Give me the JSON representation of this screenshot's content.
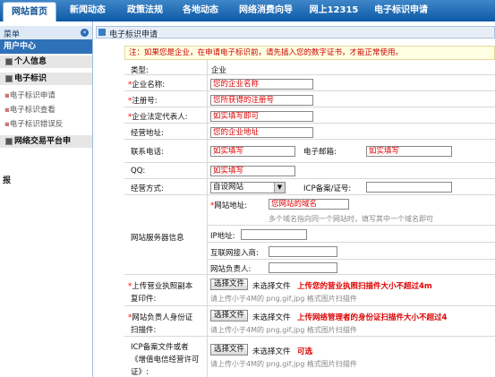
{
  "nav": {
    "items": [
      "网站首页",
      "新闻动态",
      "政策法规",
      "各地动态",
      "网络消费向导",
      "网上12315",
      "电子标识申请"
    ]
  },
  "sidebar": {
    "header": "菜单",
    "toggle": "«",
    "user_center": "用户中心",
    "personal_info": "个人信息",
    "e_label": "电子标识",
    "sub_items": [
      "电子标识申请",
      "电子标识查看",
      "电子标识错误反"
    ],
    "platform": "网络交易平台申",
    "extra": "报"
  },
  "main": {
    "title": "电子标识申请"
  },
  "form": {
    "note": "注：如果您是企业，在申请电子标识前，请先插入您的数字证书，才能正常使用。",
    "type_label": "类型:",
    "type_value": "企业",
    "company_label": "企业名称:",
    "company_value": "您的企业名称",
    "reg_label": "注册号:",
    "reg_value": "您所获得的注册号",
    "legal_label": "企业法定代表人:",
    "legal_value": "如实填写即可",
    "addr_label": "经营地址:",
    "addr_value": "您的企业地址",
    "phone_label": "联系电话:",
    "phone_value": "如实填写",
    "email_label": "电子邮箱:",
    "email_value": "如实填写",
    "qq_label": "QQ:",
    "qq_value": "如实填写",
    "mode_label": "经营方式:",
    "mode_value": "自设网站",
    "icp_label": "ICP备案/证号:",
    "server_label": "网站服务器信息",
    "site_label": "网站地址:",
    "site_value": "您网站的域名",
    "site_hint": "多个域名指向同一个网站时，填写其中一个域名即可",
    "ip_label": "IP地址:",
    "isp_label": "互联网接入商:",
    "owner_label": "网站负责人:",
    "license_label_1": "上传营业执照副本",
    "license_label_2": "复印件:",
    "choose_btn": "选择文件",
    "no_file": "未选择文件",
    "license_red": "上传您的营业执照扫描件大小不超过4m",
    "upload_hint": "请上传小于4M的 png,gif,jpg 格式图片扫描件",
    "id_label_1": "网站负责人身份证",
    "id_label_2": "扫描件:",
    "id_red": "上传网络管理者的身份证扫描件大小不超过4",
    "icp_file_label_1": "ICP备案文件或者",
    "icp_file_label_2": "《增值电信经营许可",
    "icp_file_label_3": "证》:",
    "icp_red": "可选"
  },
  "colors": {
    "nav": "#0d5aa6",
    "accent": "#2f71b8",
    "required": "#e00000"
  }
}
